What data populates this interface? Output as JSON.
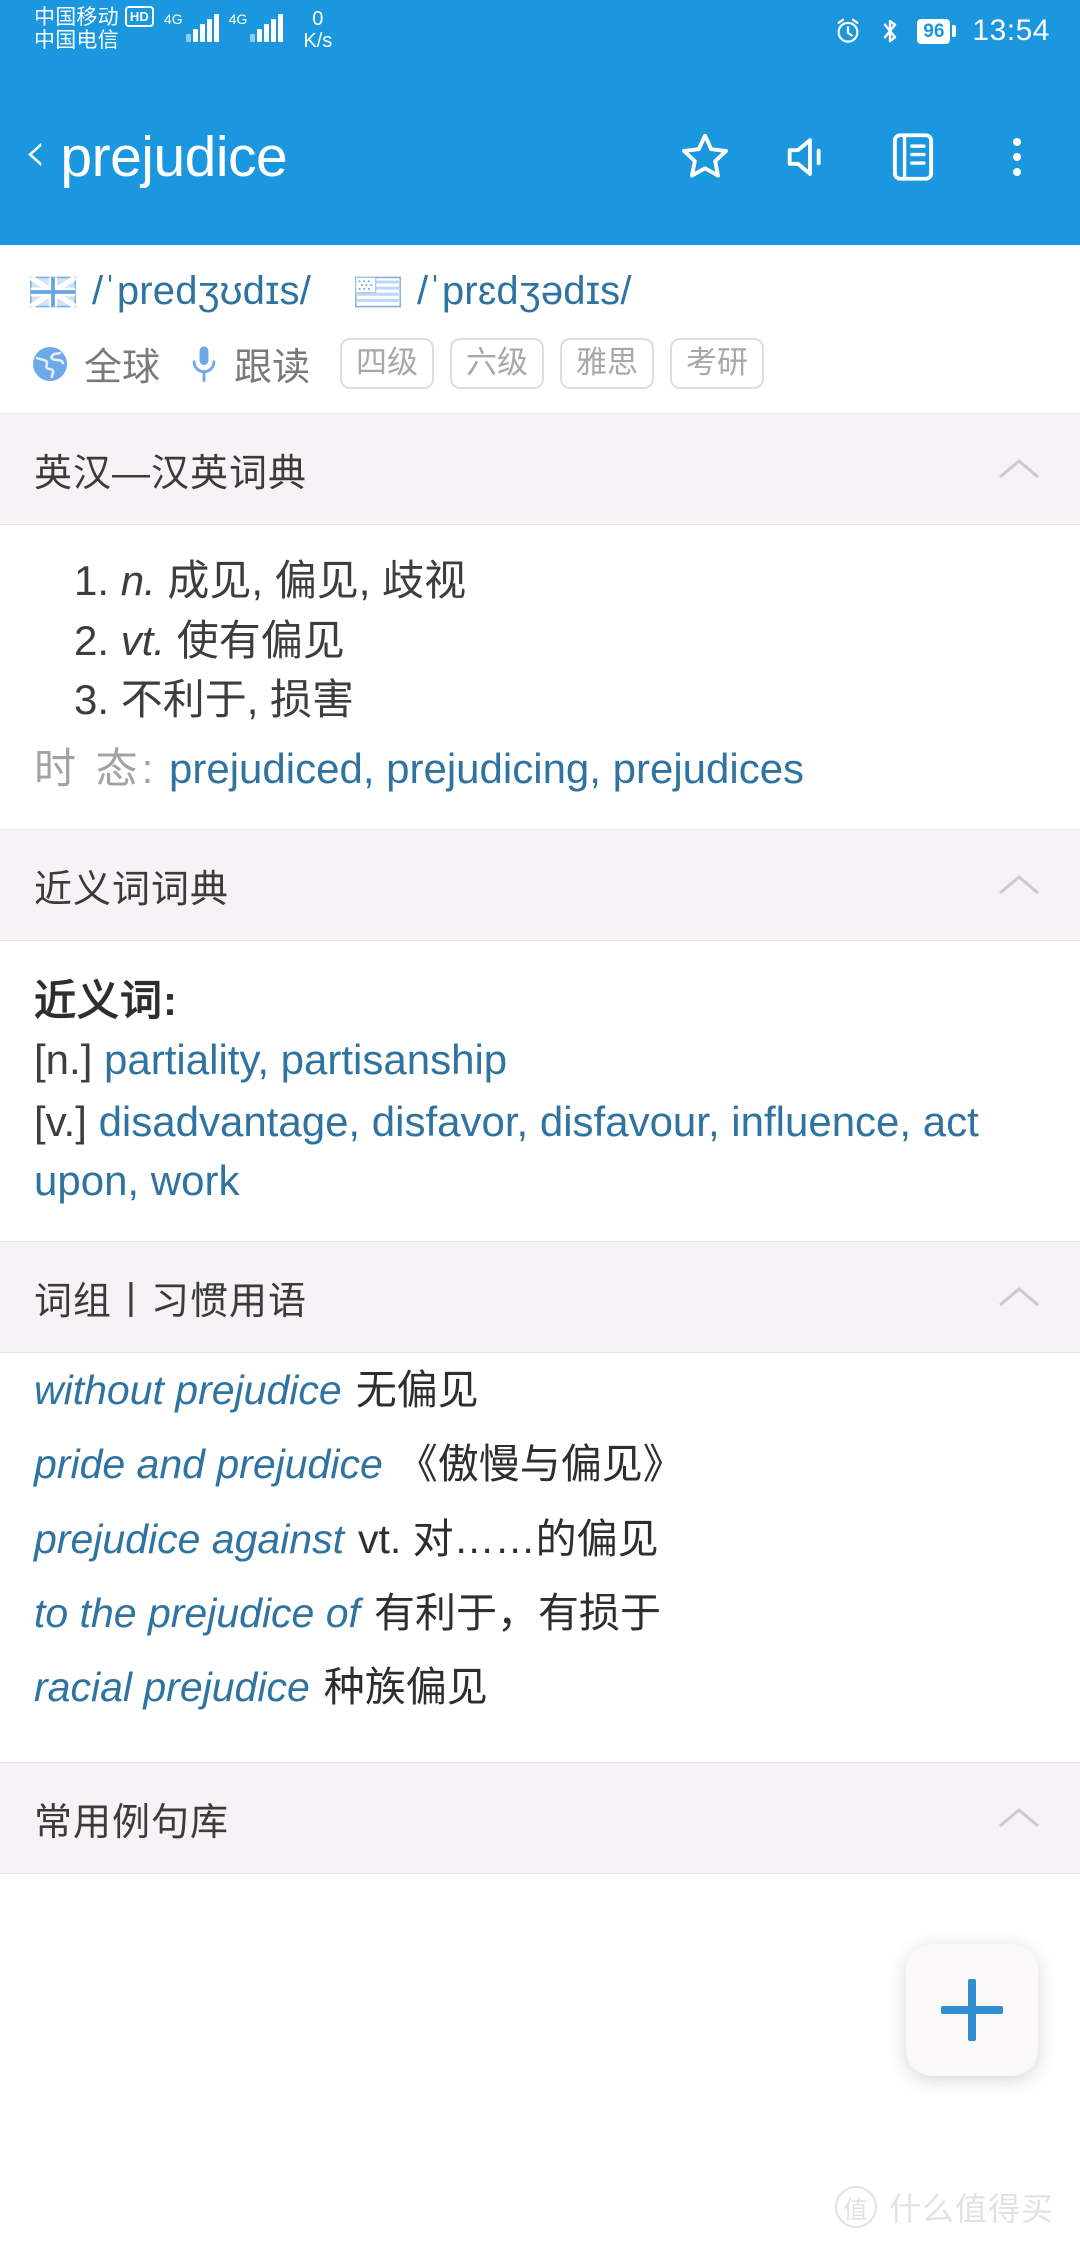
{
  "status_bar": {
    "carrier_1": "中国移动",
    "carrier_1_badge": "HD",
    "carrier_2": "中国电信",
    "network_1": "4G",
    "network_2": "4G",
    "net_speed_value": "0",
    "net_speed_unit": "K/s",
    "alarm_icon": "alarm-icon",
    "bluetooth_icon": "bluetooth-icon",
    "battery_level": "96",
    "clock": "13:54"
  },
  "app_bar": {
    "back_glyph": "‹",
    "title": "prejudice",
    "actions": [
      {
        "name": "favorite-star-icon",
        "label": "收藏"
      },
      {
        "name": "speaker-icon",
        "label": "发音"
      },
      {
        "name": "notes-icon",
        "label": "笔记"
      },
      {
        "name": "more-options-icon",
        "label": "更多"
      }
    ]
  },
  "word_head": {
    "uk_flag": "uk-flag-icon",
    "uk_phonetic": "/ˈpredʒʊdɪs/",
    "us_flag": "us-flag-icon",
    "us_phonetic": "/ˈprɛdʒədɪs/",
    "globe_icon": "globe-icon",
    "global_label": "全球",
    "mic_icon": "microphone-icon",
    "follow_read_label": "跟读",
    "tags": [
      "四级",
      "六级",
      "雅思",
      "考研"
    ]
  },
  "sections": [
    {
      "title": "英汉—汉英词典",
      "collapse_icon": "chevron-up-icon",
      "definitions": [
        {
          "pos": "n.",
          "text": "成见, 偏见, 歧视"
        },
        {
          "pos": "vt.",
          "text": "使有偏见"
        },
        {
          "pos": "",
          "text": "不利于, 损害"
        }
      ],
      "tense_label": "时 态:",
      "tense_value": "prejudiced, prejudicing, prejudices"
    },
    {
      "title": "近义词词典",
      "collapse_icon": "chevron-up-icon",
      "synonyms_heading": "近义词:",
      "synonym_groups": [
        {
          "pos": "[n.]",
          "words": "partiality, partisanship"
        },
        {
          "pos": "[v.]",
          "words": "disadvantage, disfavor, disfavour, influence, act upon, work"
        }
      ]
    },
    {
      "title": "词组丨习惯用语",
      "collapse_icon": "chevron-up-icon",
      "phrases": [
        {
          "en": "without prejudice",
          "cn": "无偏见"
        },
        {
          "en": "pride and prejudice",
          "cn": "《傲慢与偏见》"
        },
        {
          "en": "prejudice against",
          "cn": "vt. 对……的偏见"
        },
        {
          "en": "to the prejudice of",
          "cn": "有利于，有损于"
        },
        {
          "en": "racial prejudice",
          "cn": "种族偏见"
        }
      ]
    },
    {
      "title": "常用例句库",
      "collapse_icon": "chevron-up-icon"
    }
  ],
  "fab": {
    "name": "add-button",
    "glyph": "+"
  },
  "watermark": {
    "mark": "值",
    "text": "什么值得买"
  },
  "colors": {
    "accent_blue": "#1b97e0",
    "link_blue": "#2f73a0",
    "section_bg": "#f7f2f5",
    "text_dark": "#3d3d3d",
    "tag_gray": "#a8a8a8"
  }
}
